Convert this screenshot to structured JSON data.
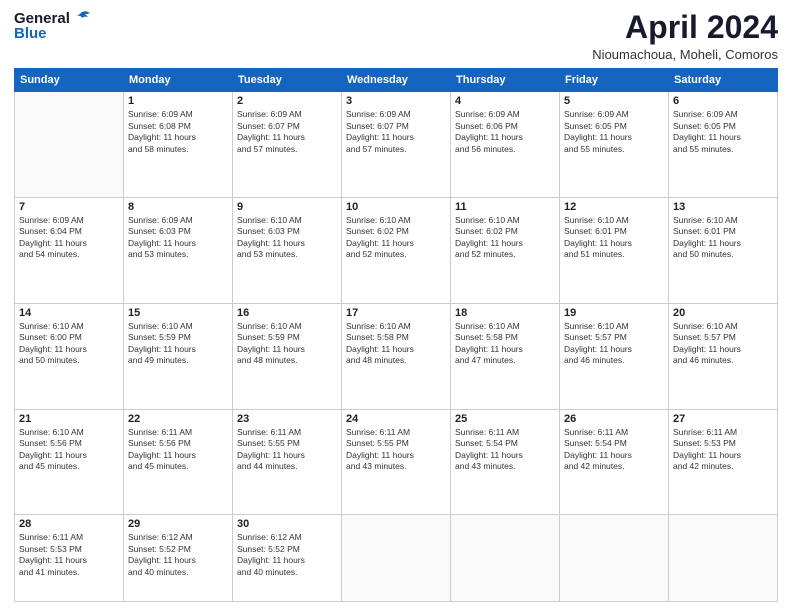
{
  "logo": {
    "general": "General",
    "blue": "Blue"
  },
  "title": "April 2024",
  "location": "Nioumachoua, Moheli, Comoros",
  "weekdays": [
    "Sunday",
    "Monday",
    "Tuesday",
    "Wednesday",
    "Thursday",
    "Friday",
    "Saturday"
  ],
  "days": [
    {
      "day": "",
      "info": ""
    },
    {
      "day": "1",
      "info": "Sunrise: 6:09 AM\nSunset: 6:08 PM\nDaylight: 11 hours\nand 58 minutes."
    },
    {
      "day": "2",
      "info": "Sunrise: 6:09 AM\nSunset: 6:07 PM\nDaylight: 11 hours\nand 57 minutes."
    },
    {
      "day": "3",
      "info": "Sunrise: 6:09 AM\nSunset: 6:07 PM\nDaylight: 11 hours\nand 57 minutes."
    },
    {
      "day": "4",
      "info": "Sunrise: 6:09 AM\nSunset: 6:06 PM\nDaylight: 11 hours\nand 56 minutes."
    },
    {
      "day": "5",
      "info": "Sunrise: 6:09 AM\nSunset: 6:05 PM\nDaylight: 11 hours\nand 55 minutes."
    },
    {
      "day": "6",
      "info": "Sunrise: 6:09 AM\nSunset: 6:05 PM\nDaylight: 11 hours\nand 55 minutes."
    },
    {
      "day": "7",
      "info": "Sunrise: 6:09 AM\nSunset: 6:04 PM\nDaylight: 11 hours\nand 54 minutes."
    },
    {
      "day": "8",
      "info": "Sunrise: 6:09 AM\nSunset: 6:03 PM\nDaylight: 11 hours\nand 53 minutes."
    },
    {
      "day": "9",
      "info": "Sunrise: 6:10 AM\nSunset: 6:03 PM\nDaylight: 11 hours\nand 53 minutes."
    },
    {
      "day": "10",
      "info": "Sunrise: 6:10 AM\nSunset: 6:02 PM\nDaylight: 11 hours\nand 52 minutes."
    },
    {
      "day": "11",
      "info": "Sunrise: 6:10 AM\nSunset: 6:02 PM\nDaylight: 11 hours\nand 52 minutes."
    },
    {
      "day": "12",
      "info": "Sunrise: 6:10 AM\nSunset: 6:01 PM\nDaylight: 11 hours\nand 51 minutes."
    },
    {
      "day": "13",
      "info": "Sunrise: 6:10 AM\nSunset: 6:01 PM\nDaylight: 11 hours\nand 50 minutes."
    },
    {
      "day": "14",
      "info": "Sunrise: 6:10 AM\nSunset: 6:00 PM\nDaylight: 11 hours\nand 50 minutes."
    },
    {
      "day": "15",
      "info": "Sunrise: 6:10 AM\nSunset: 5:59 PM\nDaylight: 11 hours\nand 49 minutes."
    },
    {
      "day": "16",
      "info": "Sunrise: 6:10 AM\nSunset: 5:59 PM\nDaylight: 11 hours\nand 48 minutes."
    },
    {
      "day": "17",
      "info": "Sunrise: 6:10 AM\nSunset: 5:58 PM\nDaylight: 11 hours\nand 48 minutes."
    },
    {
      "day": "18",
      "info": "Sunrise: 6:10 AM\nSunset: 5:58 PM\nDaylight: 11 hours\nand 47 minutes."
    },
    {
      "day": "19",
      "info": "Sunrise: 6:10 AM\nSunset: 5:57 PM\nDaylight: 11 hours\nand 46 minutes."
    },
    {
      "day": "20",
      "info": "Sunrise: 6:10 AM\nSunset: 5:57 PM\nDaylight: 11 hours\nand 46 minutes."
    },
    {
      "day": "21",
      "info": "Sunrise: 6:10 AM\nSunset: 5:56 PM\nDaylight: 11 hours\nand 45 minutes."
    },
    {
      "day": "22",
      "info": "Sunrise: 6:11 AM\nSunset: 5:56 PM\nDaylight: 11 hours\nand 45 minutes."
    },
    {
      "day": "23",
      "info": "Sunrise: 6:11 AM\nSunset: 5:55 PM\nDaylight: 11 hours\nand 44 minutes."
    },
    {
      "day": "24",
      "info": "Sunrise: 6:11 AM\nSunset: 5:55 PM\nDaylight: 11 hours\nand 43 minutes."
    },
    {
      "day": "25",
      "info": "Sunrise: 6:11 AM\nSunset: 5:54 PM\nDaylight: 11 hours\nand 43 minutes."
    },
    {
      "day": "26",
      "info": "Sunrise: 6:11 AM\nSunset: 5:54 PM\nDaylight: 11 hours\nand 42 minutes."
    },
    {
      "day": "27",
      "info": "Sunrise: 6:11 AM\nSunset: 5:53 PM\nDaylight: 11 hours\nand 42 minutes."
    },
    {
      "day": "28",
      "info": "Sunrise: 6:11 AM\nSunset: 5:53 PM\nDaylight: 11 hours\nand 41 minutes."
    },
    {
      "day": "29",
      "info": "Sunrise: 6:12 AM\nSunset: 5:52 PM\nDaylight: 11 hours\nand 40 minutes."
    },
    {
      "day": "30",
      "info": "Sunrise: 6:12 AM\nSunset: 5:52 PM\nDaylight: 11 hours\nand 40 minutes."
    },
    {
      "day": "",
      "info": ""
    },
    {
      "day": "",
      "info": ""
    },
    {
      "day": "",
      "info": ""
    },
    {
      "day": "",
      "info": ""
    }
  ]
}
